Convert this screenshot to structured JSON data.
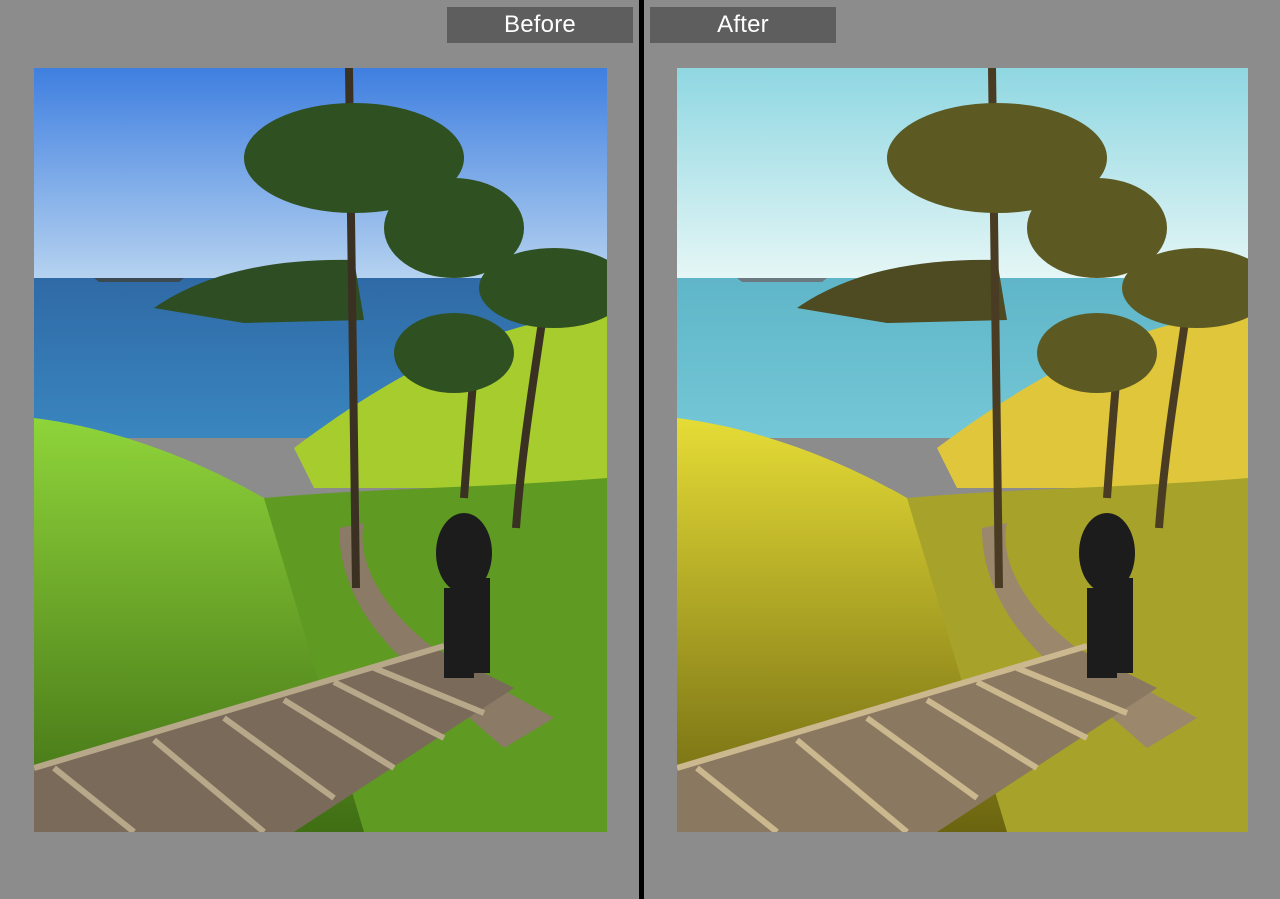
{
  "window": {
    "before_label": "Before",
    "after_label": "After"
  },
  "photos": {
    "before": {
      "sky_top": "#3f7fe0",
      "sky_bottom": "#b8d4f0",
      "sea": "#2f6aa6",
      "grass": "#7cc52a",
      "grass_dark": "#3f6e14",
      "path": "#7a6a5a"
    },
    "after": {
      "sky_top": "#8fd7e2",
      "sky_bottom": "#e7f7f6",
      "sea": "#5fb6c8",
      "grass": "#d8d12a",
      "grass_dark": "#6a6410",
      "path": "#8a7860"
    }
  },
  "colors": {
    "pane_bg": "#8c8c8c",
    "label_bg": "#5e5e5e",
    "divider": "#000000"
  }
}
